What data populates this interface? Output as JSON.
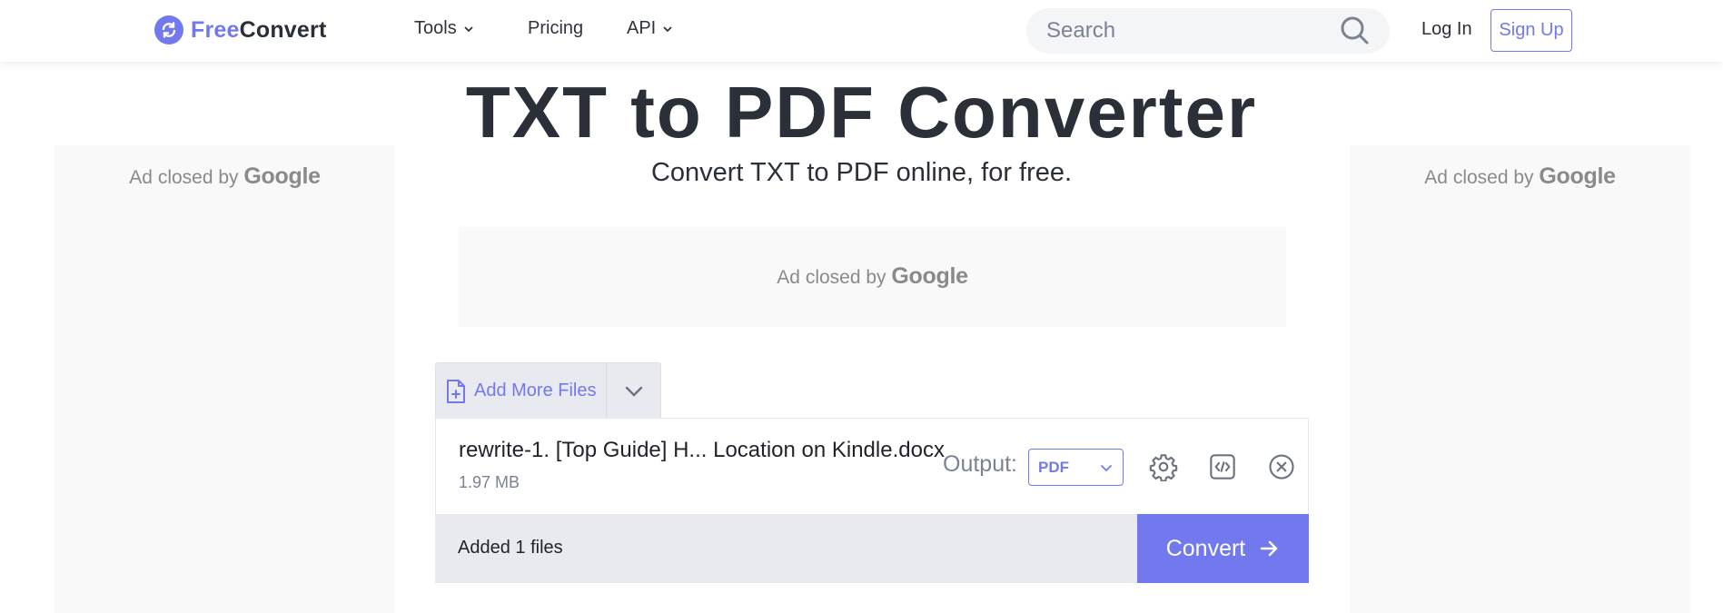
{
  "header": {
    "logo": {
      "part1": "Free",
      "part2": "Convert",
      "icon": "refresh-circle-icon"
    },
    "nav": [
      {
        "label": "Tools",
        "has_dropdown": true
      },
      {
        "label": "Pricing",
        "has_dropdown": false
      },
      {
        "label": "API",
        "has_dropdown": true
      }
    ],
    "search": {
      "placeholder": "Search",
      "value": "",
      "icon": "search-icon"
    },
    "login_label": "Log In",
    "signup_label": "Sign Up"
  },
  "main": {
    "title": "TXT to PDF Converter",
    "subtitle": "Convert TXT to PDF online, for free."
  },
  "ads": {
    "left": {
      "prefix": "Ad closed by",
      "brand": "Google"
    },
    "right": {
      "prefix": "Ad closed by",
      "brand": "Google"
    },
    "middle": {
      "prefix": "Ad closed by",
      "brand": "Google"
    }
  },
  "uploader": {
    "add_files_label": "Add More Files",
    "file": {
      "name": "rewrite-1. [Top Guide] H... Location on Kindle.docx",
      "size": "1.97 MB",
      "output_label": "Output:",
      "output_format": "PDF"
    },
    "status": "Added 1 files",
    "convert_label": "Convert"
  },
  "colors": {
    "accent": "#7279ee",
    "text_dark": "#2a2f38",
    "muted": "#7b8292",
    "panel_bg": "#e8eaef"
  }
}
